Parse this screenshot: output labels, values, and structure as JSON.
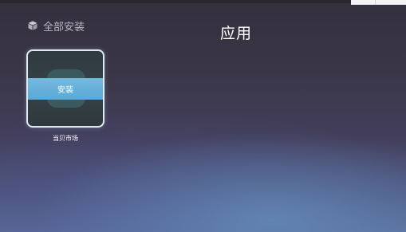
{
  "filter": {
    "label": "全部安装",
    "icon": "package-box-icon"
  },
  "page": {
    "title": "应用"
  },
  "apps": [
    {
      "name": "当贝市场",
      "action_label": "安装",
      "icon": "app-icon"
    }
  ],
  "colors": {
    "accent_install": "#5aa9d6",
    "text_primary": "#ffffff",
    "text_muted": "#b9b6c2",
    "tile_border": "#dfe9f2"
  }
}
